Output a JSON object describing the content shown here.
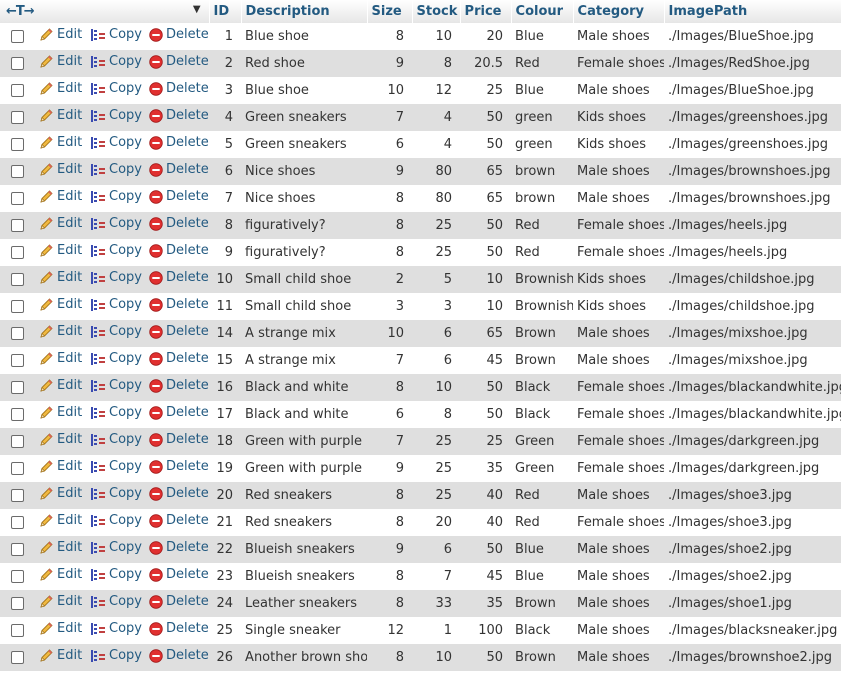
{
  "header": {
    "arrows": "←T→",
    "sort_indicator": "▼",
    "columns": [
      "ID",
      "Description",
      "Size",
      "Stock",
      "Price",
      "Colour",
      "Category",
      "ImagePath"
    ]
  },
  "actions": {
    "edit": "Edit",
    "copy": "Copy",
    "delete": "Delete"
  },
  "colors": {
    "link": "#235a81",
    "row_alt": "#dfdfdf",
    "delete": "#e03030",
    "pencil": "#e0a020"
  },
  "rows": [
    {
      "id": "1",
      "description": "Blue shoe",
      "size": "8",
      "stock": "10",
      "price": "20",
      "colour": "Blue",
      "category": "Male shoes",
      "image": "./Images/BlueShoe.jpg"
    },
    {
      "id": "2",
      "description": "Red shoe",
      "size": "9",
      "stock": "8",
      "price": "20.5",
      "colour": "Red",
      "category": "Female shoes",
      "image": "./Images/RedShoe.jpg"
    },
    {
      "id": "3",
      "description": "Blue shoe",
      "size": "10",
      "stock": "12",
      "price": "25",
      "colour": "Blue",
      "category": "Male shoes",
      "image": "./Images/BlueShoe.jpg"
    },
    {
      "id": "4",
      "description": "Green sneakers",
      "size": "7",
      "stock": "4",
      "price": "50",
      "colour": "green",
      "category": "Kids shoes",
      "image": "./Images/greenshoes.jpg"
    },
    {
      "id": "5",
      "description": "Green sneakers",
      "size": "6",
      "stock": "4",
      "price": "50",
      "colour": "green",
      "category": "Kids shoes",
      "image": "./Images/greenshoes.jpg"
    },
    {
      "id": "6",
      "description": "Nice shoes",
      "size": "9",
      "stock": "80",
      "price": "65",
      "colour": "brown",
      "category": "Male shoes",
      "image": "./Images/brownshoes.jpg"
    },
    {
      "id": "7",
      "description": "Nice shoes",
      "size": "8",
      "stock": "80",
      "price": "65",
      "colour": "brown",
      "category": "Male shoes",
      "image": "./Images/brownshoes.jpg"
    },
    {
      "id": "8",
      "description": "figuratively?",
      "size": "8",
      "stock": "25",
      "price": "50",
      "colour": "Red",
      "category": "Female shoes",
      "image": "./Images/heels.jpg"
    },
    {
      "id": "9",
      "description": "figuratively?",
      "size": "8",
      "stock": "25",
      "price": "50",
      "colour": "Red",
      "category": "Female shoes",
      "image": "./Images/heels.jpg"
    },
    {
      "id": "10",
      "description": "Small child shoe",
      "size": "2",
      "stock": "5",
      "price": "10",
      "colour": "Brownish",
      "category": "Kids shoes",
      "image": "./Images/childshoe.jpg"
    },
    {
      "id": "11",
      "description": "Small child shoe",
      "size": "3",
      "stock": "3",
      "price": "10",
      "colour": "Brownish",
      "category": "Kids shoes",
      "image": "./Images/childshoe.jpg"
    },
    {
      "id": "14",
      "description": "A strange mix",
      "size": "10",
      "stock": "6",
      "price": "65",
      "colour": "Brown",
      "category": "Male shoes",
      "image": "./Images/mixshoe.jpg"
    },
    {
      "id": "15",
      "description": "A strange mix",
      "size": "7",
      "stock": "6",
      "price": "45",
      "colour": "Brown",
      "category": "Male shoes",
      "image": "./Images/mixshoe.jpg"
    },
    {
      "id": "16",
      "description": "Black and white",
      "size": "8",
      "stock": "10",
      "price": "50",
      "colour": "Black",
      "category": "Female shoes",
      "image": "./Images/blackandwhite.jpg"
    },
    {
      "id": "17",
      "description": "Black and white",
      "size": "6",
      "stock": "8",
      "price": "50",
      "colour": "Black",
      "category": "Female shoes",
      "image": "./Images/blackandwhite.jpg"
    },
    {
      "id": "18",
      "description": "Green with purple",
      "size": "7",
      "stock": "25",
      "price": "25",
      "colour": "Green",
      "category": "Female shoes",
      "image": "./Images/darkgreen.jpg"
    },
    {
      "id": "19",
      "description": "Green with purple",
      "size": "9",
      "stock": "25",
      "price": "35",
      "colour": "Green",
      "category": "Female shoes",
      "image": "./Images/darkgreen.jpg"
    },
    {
      "id": "20",
      "description": "Red sneakers",
      "size": "8",
      "stock": "25",
      "price": "40",
      "colour": "Red",
      "category": "Male shoes",
      "image": "./Images/shoe3.jpg"
    },
    {
      "id": "21",
      "description": "Red sneakers",
      "size": "8",
      "stock": "20",
      "price": "40",
      "colour": "Red",
      "category": "Female shoes",
      "image": "./Images/shoe3.jpg"
    },
    {
      "id": "22",
      "description": "Blueish sneakers",
      "size": "9",
      "stock": "6",
      "price": "50",
      "colour": "Blue",
      "category": "Male shoes",
      "image": "./Images/shoe2.jpg"
    },
    {
      "id": "23",
      "description": "Blueish sneakers",
      "size": "8",
      "stock": "7",
      "price": "45",
      "colour": "Blue",
      "category": "Male shoes",
      "image": "./Images/shoe2.jpg"
    },
    {
      "id": "24",
      "description": "Leather sneakers",
      "size": "8",
      "stock": "33",
      "price": "35",
      "colour": "Brown",
      "category": "Male shoes",
      "image": "./Images/shoe1.jpg"
    },
    {
      "id": "25",
      "description": "Single sneaker",
      "size": "12",
      "stock": "1",
      "price": "100",
      "colour": "Black",
      "category": "Male shoes",
      "image": "./Images/blacksneaker.jpg"
    },
    {
      "id": "26",
      "description": "Another brown shoe",
      "size": "8",
      "stock": "10",
      "price": "50",
      "colour": "Brown",
      "category": "Male shoes",
      "image": "./Images/brownshoe2.jpg"
    }
  ]
}
